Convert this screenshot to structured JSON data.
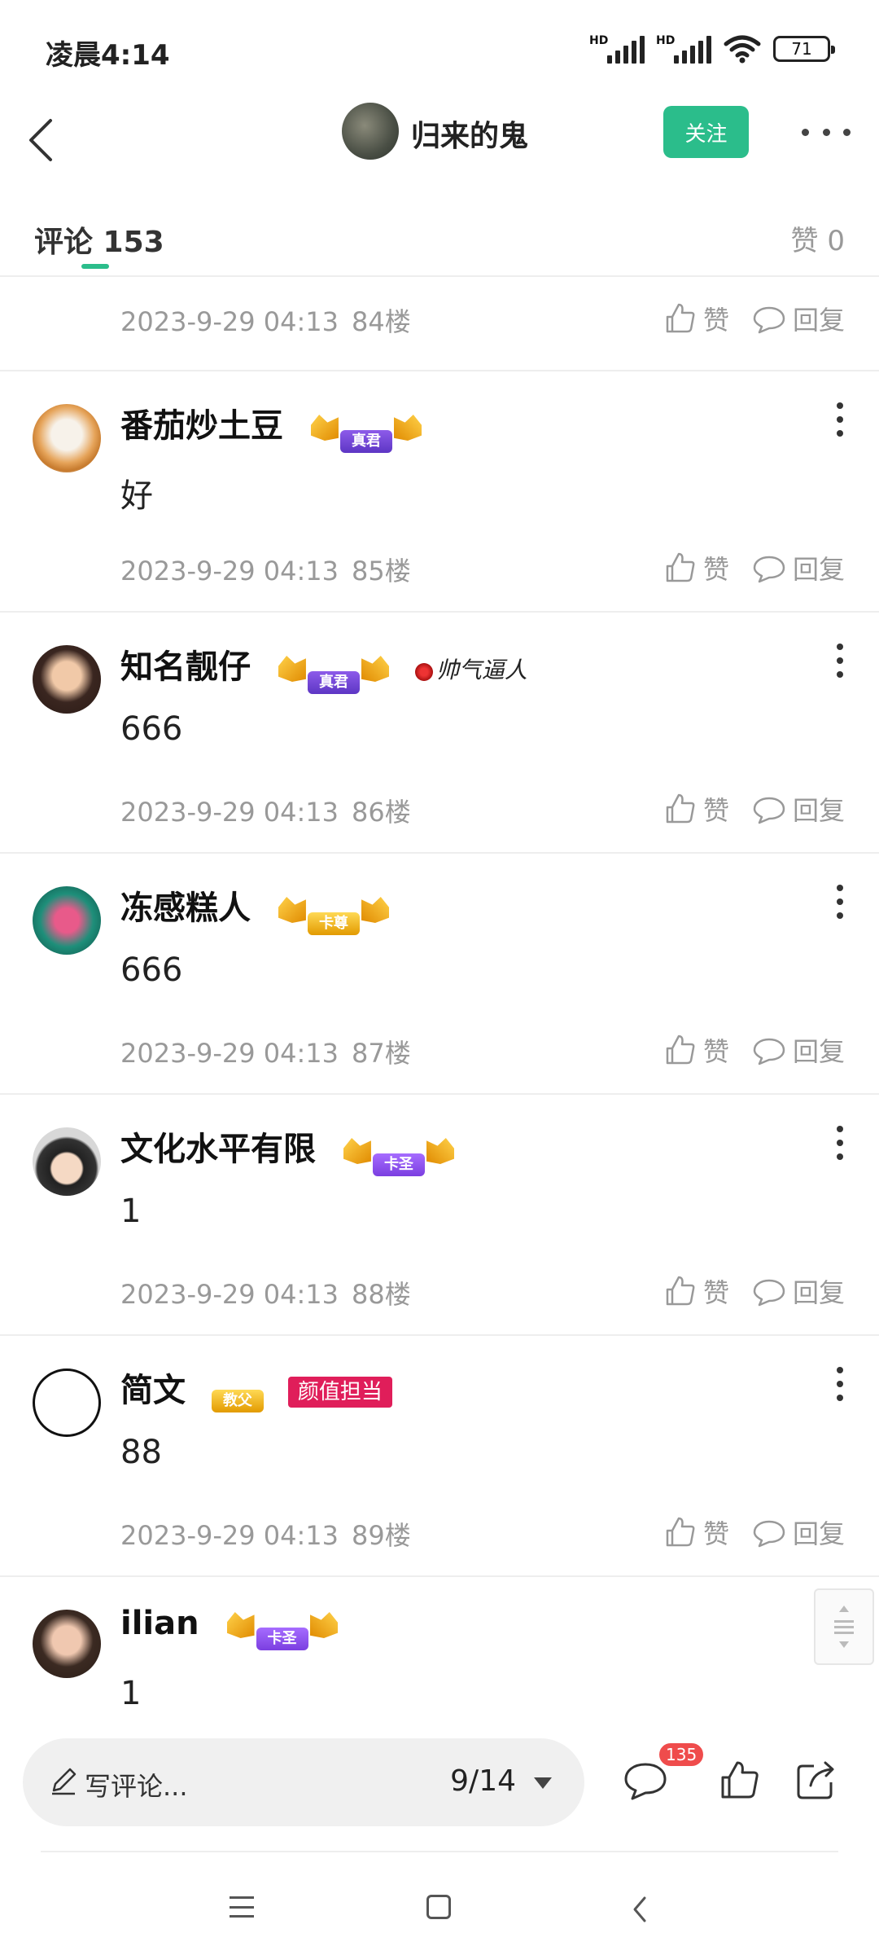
{
  "status_bar": {
    "time": "凌晨4:14",
    "signal1": "HD",
    "signal2": "HD",
    "battery": "71"
  },
  "header": {
    "username": "归来的鬼",
    "follow_label": "关注"
  },
  "tabs": {
    "comments_label": "评论 153",
    "likes_label": "赞 0"
  },
  "actions": {
    "like_label": "赞",
    "reply_label": "回复"
  },
  "top_row": {
    "time": "2023-9-29 04:13",
    "floor": "84楼"
  },
  "comments": [
    {
      "user": "番茄炒土豆",
      "badge": "真君",
      "text": "好",
      "time": "2023-9-29 04:13",
      "floor": "85楼"
    },
    {
      "user": "知名靓仔",
      "badge": "真君",
      "tag": "帅气逼人",
      "text": "666",
      "time": "2023-9-29 04:13",
      "floor": "86楼"
    },
    {
      "user": "冻感糕人",
      "badge": "卡尊",
      "text": "666",
      "time": "2023-9-29 04:13",
      "floor": "87楼"
    },
    {
      "user": "文化水平有限",
      "badge": "卡圣",
      "text": "1",
      "time": "2023-9-29 04:13",
      "floor": "88楼"
    },
    {
      "user": "简文",
      "badge": "教父",
      "tag": "颜值担当",
      "text": "88",
      "time": "2023-9-29 04:13",
      "floor": "89楼"
    },
    {
      "user": "ilian",
      "badge": "卡圣",
      "text": "1"
    }
  ],
  "bottom_bar": {
    "placeholder": "写评论...",
    "page_indicator": "9/14",
    "comment_count": "135"
  },
  "colors": {
    "accent": "#2bbd8b",
    "badge_red": "#ef4c4c",
    "tag_pink": "#e01e5a"
  }
}
